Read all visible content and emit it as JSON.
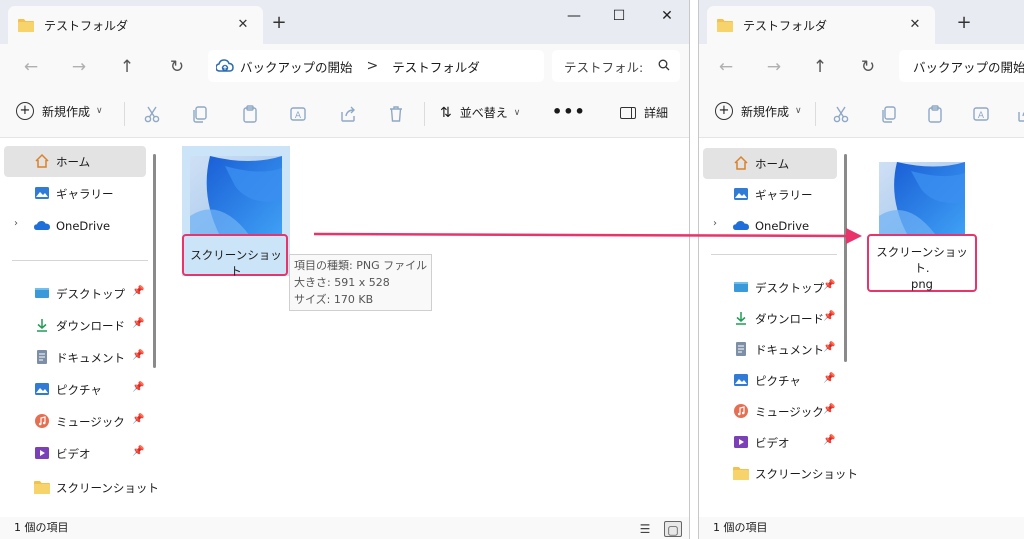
{
  "left": {
    "tab_title": "テストフォルダ",
    "tab_close": "✕",
    "new_tab": "+",
    "window_controls": {
      "minimize": "—",
      "maximize": "☐",
      "close": "✕"
    },
    "nav": {
      "back": "←",
      "forward": "→",
      "up": "↑",
      "refresh": "↻"
    },
    "address": {
      "backup": "バックアップの開始",
      "separator": ">",
      "folder": "テストフォルダ"
    },
    "search": {
      "text": "テストフォル:",
      "icon": "search-icon"
    },
    "toolbar": {
      "new_label": "新規作成",
      "sort_label": "並べ替え",
      "more": "•••",
      "detail_label": "詳細"
    },
    "sidebar": [
      {
        "label": "ホーム",
        "icon": "home-icon",
        "selected": true
      },
      {
        "label": "ギャラリー",
        "icon": "gallery-icon"
      },
      {
        "label": "OneDrive",
        "icon": "onedrive-icon",
        "expandable": true
      },
      {
        "label": "デスクトップ",
        "icon": "desktop-icon",
        "pinned": true
      },
      {
        "label": "ダウンロード",
        "icon": "download-icon",
        "pinned": true
      },
      {
        "label": "ドキュメント",
        "icon": "document-icon",
        "pinned": true
      },
      {
        "label": "ピクチャ",
        "icon": "pictures-icon",
        "pinned": true
      },
      {
        "label": "ミュージック",
        "icon": "music-icon",
        "pinned": true
      },
      {
        "label": "ビデオ",
        "icon": "video-icon",
        "pinned": true
      },
      {
        "label": "スクリーンショット",
        "icon": "folder-icon"
      }
    ],
    "file": {
      "name": "スクリーンショット"
    },
    "tooltip": {
      "type": "項目の種類: PNG ファイル",
      "size_dims": "大きさ: 591 x 528",
      "file_size": "サイズ: 170 KB"
    },
    "status": "1 個の項目"
  },
  "right": {
    "tab_title": "テストフォルダ",
    "tab_close": "✕",
    "new_tab": "+",
    "nav": {
      "back": "←",
      "forward": "→",
      "up": "↑",
      "refresh": "↻"
    },
    "address": {
      "backup": "バックアップの開始"
    },
    "toolbar": {
      "new_label": "新規作成"
    },
    "sidebar": [
      {
        "label": "ホーム",
        "icon": "home-icon",
        "selected": true
      },
      {
        "label": "ギャラリー",
        "icon": "gallery-icon"
      },
      {
        "label": "OneDrive",
        "icon": "onedrive-icon",
        "expandable": true
      },
      {
        "label": "デスクトップ",
        "icon": "desktop-icon",
        "pinned": true
      },
      {
        "label": "ダウンロード",
        "icon": "download-icon",
        "pinned": true
      },
      {
        "label": "ドキュメント",
        "icon": "document-icon",
        "pinned": true
      },
      {
        "label": "ピクチャ",
        "icon": "pictures-icon",
        "pinned": true
      },
      {
        "label": "ミュージック",
        "icon": "music-icon",
        "pinned": true
      },
      {
        "label": "ビデオ",
        "icon": "video-icon",
        "pinned": true
      },
      {
        "label": "スクリーンショット",
        "icon": "folder-icon"
      }
    ],
    "file": {
      "name_line1": "スクリーンショット.",
      "name_line2": "png"
    },
    "status": "1 個の項目"
  },
  "colors": {
    "highlight_box": "#e8336b",
    "arrow": "#e8336b",
    "selection": "#cce4f7",
    "folder": "#f2c14e"
  }
}
